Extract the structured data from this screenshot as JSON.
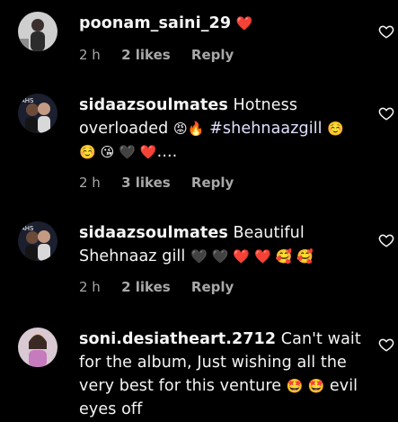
{
  "comments": [
    {
      "username": "poonam_saini_29",
      "text": "",
      "emojis": "❤️",
      "time": "2 h",
      "likes": "2 likes",
      "reply": "Reply"
    },
    {
      "username": "sidaazsoulmates",
      "text_pre": "Hotness overloaded",
      "emojis_a": "😡🔥",
      "hashtag": "#shehnaazgill",
      "emojis_b": "☺️ ☺️ 😘 🖤 ❤️",
      "suffix": "....",
      "time": "2 h",
      "likes": "3 likes",
      "reply": "Reply"
    },
    {
      "username": "sidaazsoulmates",
      "text": "Beautiful Shehnaaz gill",
      "emojis": "🖤 🖤 ❤️ ❤️ 🥰 🥰",
      "time": "2 h",
      "likes": "2 likes",
      "reply": "Reply"
    },
    {
      "username": "soni.desiatheart.2712",
      "text": "Can't wait for the album, Just wishing all the very best for this venture",
      "emojis": "🤩 🤩",
      "text_post": "evil eyes off"
    }
  ],
  "icons": {
    "like": "heart-outline-icon"
  },
  "colors": {
    "background": "#000000",
    "secondary_text": "#a8a8a8",
    "heart": "#ff2d55"
  }
}
